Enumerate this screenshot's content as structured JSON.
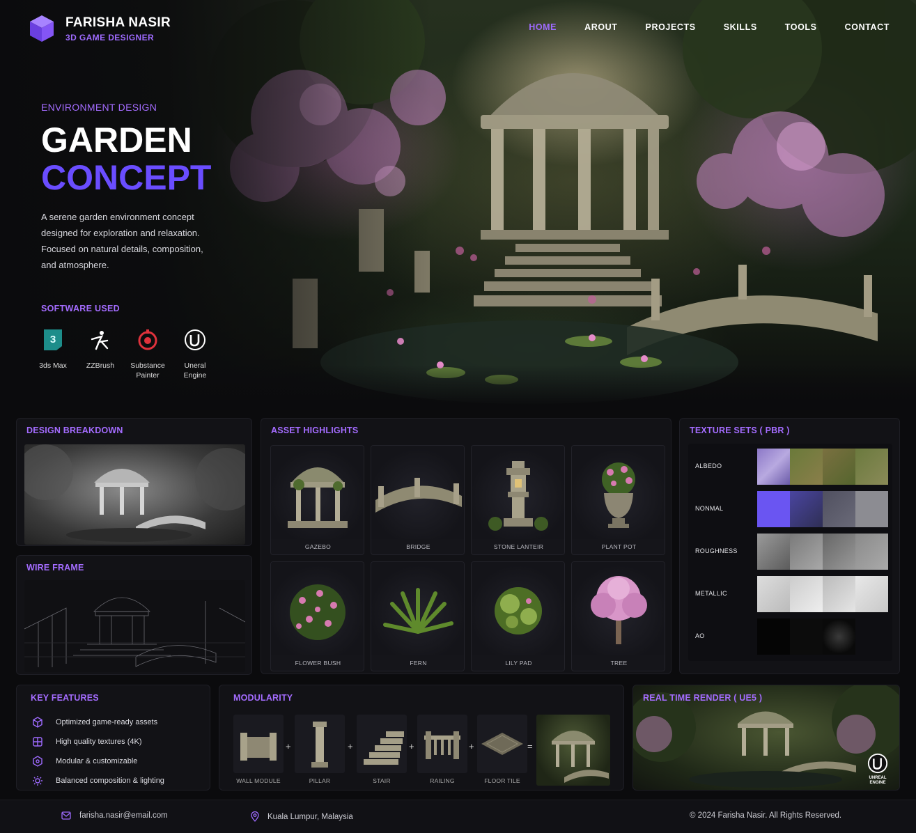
{
  "brand": {
    "name": "FARISHA NASIR",
    "role": "3D GAME DESIGNER",
    "accent": "#9f6bff"
  },
  "nav": {
    "items": [
      "HOME",
      "AROUT",
      "PROJECTS",
      "SKILLS",
      "TOOLS",
      "CONTACT"
    ],
    "active": "HOME"
  },
  "hero": {
    "eyebrow": "ENVIRONMENT DESIGN",
    "title_line1": "GARDEN",
    "title_line2": "CONCEPT",
    "description": "A serene garden environment concept designed for exploration and relaxation. Focused on natural details, composition, and atmosphere.",
    "software_title": "SOFTWARE USED",
    "software": [
      {
        "label": "3ds Max",
        "icon": "3ds-max-icon"
      },
      {
        "label": "ZZBrush",
        "icon": "zbrush-icon"
      },
      {
        "label": "Substance Painter",
        "icon": "substance-painter-icon"
      },
      {
        "label": "Uneral Engine",
        "icon": "unreal-engine-icon"
      }
    ]
  },
  "design_breakdown": {
    "title": "DESIGN BREAKDOWN"
  },
  "wire_frame": {
    "title": "WIRE FRAME"
  },
  "asset_highlights": {
    "title": "ASSET HIGHLIGHTS",
    "assets": [
      "GAZEBO",
      "BRIDGE",
      "STONE LANTEIR",
      "PLANT POT",
      "FLOWER BUSH",
      "FERN",
      "LILY PAD",
      "TREE"
    ]
  },
  "texture_sets": {
    "title": "TEXTURE SETS ( PBR )",
    "maps": [
      "ALBEDO",
      "NONMAL",
      "ROUGHNESS",
      "METALLIC",
      "AO"
    ]
  },
  "key_features": {
    "title": "KEY FEATURES",
    "items": [
      "Optimized game-ready assets",
      "High quality textures (4K)",
      "Modular & customizable",
      "Balanced composition & lighting"
    ]
  },
  "modularity": {
    "title": "MODULARITY",
    "parts": [
      "WALL MODULE",
      "PILLAR",
      "STAIR",
      "RAILING",
      "FLOOR TILE"
    ],
    "plus": "+",
    "equals": "="
  },
  "realtime": {
    "title": "REAL TIME RENDER ( UE5 )",
    "badge": "UNREAL ENGINE"
  },
  "footer": {
    "email": "farisha.nasir@email.com",
    "location": "Kuala Lumpur, Malaysia",
    "copyright": "© 2024 Farisha Nasir. All Rights Reserved."
  }
}
